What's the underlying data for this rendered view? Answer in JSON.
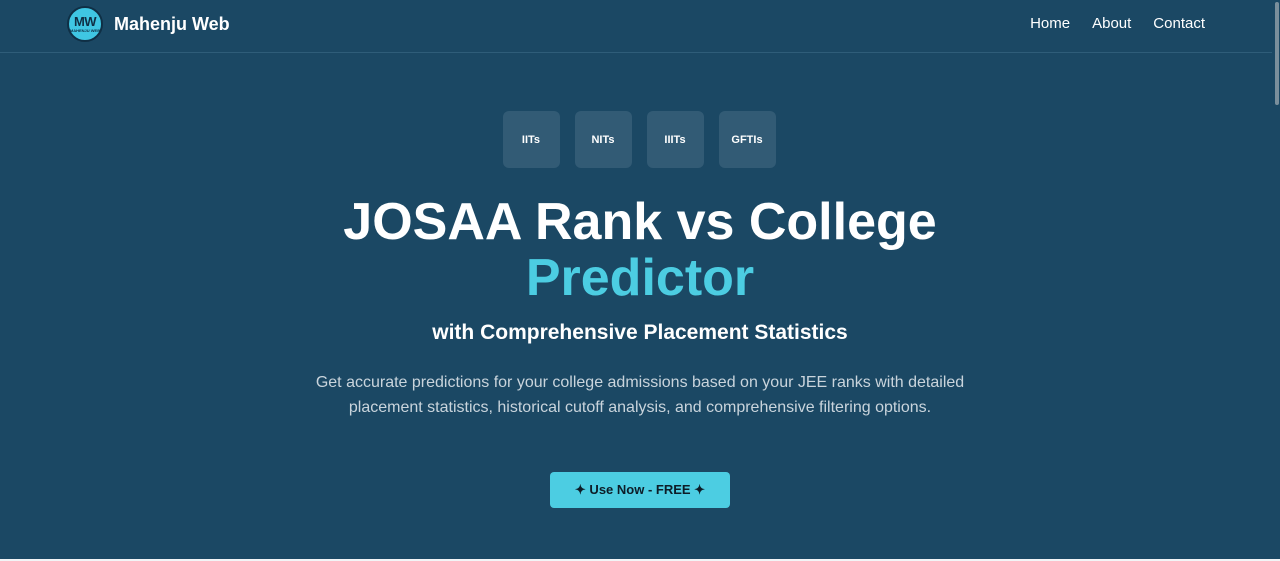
{
  "navbar": {
    "logo_text": "MW",
    "logo_subtext": "MAHENJU WEB",
    "brand_name": "Mahenju Web",
    "links": [
      {
        "label": "Home"
      },
      {
        "label": "About"
      },
      {
        "label": "Contact"
      }
    ]
  },
  "hero": {
    "badges": [
      {
        "label": "IITs"
      },
      {
        "label": "NITs"
      },
      {
        "label": "IIITs"
      },
      {
        "label": "GFTIs"
      }
    ],
    "title_main": "JOSAA Rank vs College",
    "title_accent": "Predictor",
    "subtitle": "with Comprehensive Placement Statistics",
    "description": "Get accurate predictions for your college admissions based on your JEE ranks with detailed placement statistics, historical cutoff analysis, and comprehensive filtering options.",
    "cta_label": "✦ Use Now - FREE ✦"
  },
  "colors": {
    "background": "#1b4864",
    "accent": "#4ccde2",
    "badge_bg": "#325b75"
  }
}
